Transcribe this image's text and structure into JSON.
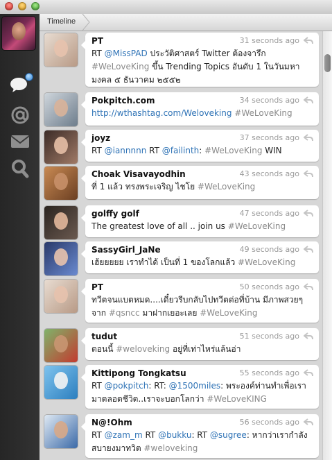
{
  "window": {
    "colors": {
      "close": "#d9352c",
      "minimize": "#d99a1f",
      "zoom": "#3f9f2e"
    }
  },
  "sidebar": {
    "icons": [
      "speech-bubble-icon",
      "at-sign-icon",
      "envelope-icon",
      "magnifier-icon"
    ],
    "badge_color": "#2a7fd6"
  },
  "header": {
    "title": "Timeline"
  },
  "colors": {
    "link": "#2f73b6",
    "hashtag": "#8a8a8a",
    "time": "#9a9a9a"
  },
  "tweets": [
    {
      "user": "PT",
      "time": "31 seconds ago",
      "parts": [
        [
          "t",
          "RT "
        ],
        [
          "m",
          "@MissPAD"
        ],
        [
          "t",
          " ประวัติศาสตร์ Twitter ต้องจารึก "
        ],
        [
          "h",
          "#WeLoveKing"
        ],
        [
          "t",
          " ขึ้น Trending Topics อันดับ 1 ในวันมหามงคล ๕ ธันวาคม ๒๕๕๒"
        ]
      ]
    },
    {
      "user": "Pokpitch.com",
      "time": "34 seconds ago",
      "parts": [
        [
          "u",
          "http://wthashtag.com/Weloveking"
        ],
        [
          "t",
          " "
        ],
        [
          "h",
          "#WeLoveKing"
        ]
      ]
    },
    {
      "user": "joyz",
      "time": "37 seconds ago",
      "parts": [
        [
          "t",
          "RT "
        ],
        [
          "m",
          "@iannnnn"
        ],
        [
          "t",
          " RT "
        ],
        [
          "m",
          "@failinth"
        ],
        [
          "t",
          ": "
        ],
        [
          "h",
          "#WeLoveKing"
        ],
        [
          "t",
          " WIN"
        ]
      ]
    },
    {
      "user": "Choak Visavayodhin",
      "time": "43 seconds ago",
      "parts": [
        [
          "t",
          "ที่ 1 แล้ว ทรงพระเจริญ ไชโย "
        ],
        [
          "h",
          "#WeLoveKing"
        ]
      ]
    },
    {
      "user": "golffy golf",
      "time": "47 seconds ago",
      "parts": [
        [
          "t",
          "The greatest love of all .. join us "
        ],
        [
          "h",
          "#WeLoveKing"
        ]
      ]
    },
    {
      "user": "SassyGirl_JaNe",
      "time": "49 seconds ago",
      "parts": [
        [
          "t",
          "เฮ้ยยยยย เราทำได้ เป็นที่ 1 ของโลกแล้ว  "
        ],
        [
          "h",
          "#WeLoveKing"
        ]
      ]
    },
    {
      "user": "PT",
      "time": "50 seconds ago",
      "parts": [
        [
          "t",
          "ทวีตจนแบตหมด....เดี๋ยวรีบกลับไปทวีตต่อที่บ้าน มีภาพสวยๆ จาก "
        ],
        [
          "h",
          "#qsncc"
        ],
        [
          "t",
          " มาฝากเยอะเลย "
        ],
        [
          "h",
          "#WeLoveKing"
        ]
      ]
    },
    {
      "user": "tudut",
      "time": "51 seconds ago",
      "parts": [
        [
          "t",
          "ตอนนี้ "
        ],
        [
          "h",
          "#weloveking"
        ],
        [
          "t",
          " อยู่ที่เท่าไหร่แล้นอ่า"
        ]
      ]
    },
    {
      "user": "Kittipong Tongkatsu",
      "time": "55 seconds ago",
      "parts": [
        [
          "t",
          "RT "
        ],
        [
          "m",
          "@pokpitch"
        ],
        [
          "t",
          ": RT: "
        ],
        [
          "m",
          "@1500miles"
        ],
        [
          "t",
          ": พระองค์ท่านทำเพื่อเรามาตลอดชีวิต..เราจะบอกโลกว่า "
        ],
        [
          "h",
          "#WeLoveKING"
        ]
      ]
    },
    {
      "user": "N@!Ohm",
      "time": "56 seconds ago",
      "parts": [
        [
          "t",
          "RT "
        ],
        [
          "m",
          "@zam_m"
        ],
        [
          "t",
          " RT "
        ],
        [
          "m",
          "@bukku"
        ],
        [
          "t",
          ": RT "
        ],
        [
          "m",
          "@sugree"
        ],
        [
          "t",
          ": หากว่าเรากำลังสบายงมาทวิต "
        ],
        [
          "h",
          "#weloveking"
        ]
      ]
    }
  ]
}
